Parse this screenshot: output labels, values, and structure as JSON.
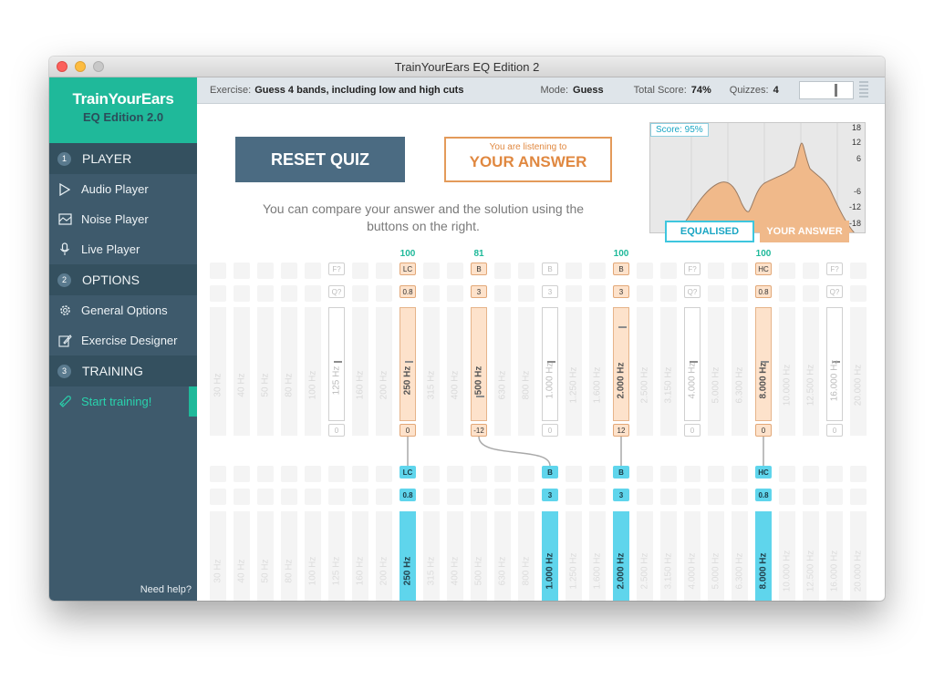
{
  "window": {
    "title": "TrainYourEars EQ Edition 2"
  },
  "brand": {
    "name": "TrainYourEars",
    "edition": "EQ Edition 2.0"
  },
  "sidebar": {
    "sections": [
      {
        "num": "1",
        "label": "PLAYER",
        "items": [
          "Audio Player",
          "Noise Player",
          "Live Player"
        ],
        "icons": [
          "play-icon",
          "noise-icon",
          "mic-icon"
        ]
      },
      {
        "num": "2",
        "label": "OPTIONS",
        "items": [
          "General Options",
          "Exercise Designer"
        ],
        "icons": [
          "gear-icon",
          "edit-icon"
        ]
      },
      {
        "num": "3",
        "label": "TRAINING",
        "items": [
          "Start training!"
        ],
        "icons": [
          "rocket-icon"
        ]
      }
    ],
    "help": "Need help?"
  },
  "topbar": {
    "exercise_label": "Exercise:",
    "exercise_value": "Guess 4 bands, including low and high cuts",
    "mode_label": "Mode:",
    "mode_value": "Guess",
    "score_label": "Total Score:",
    "score_value": "74%",
    "quizzes_label": "Quizzes:",
    "quizzes_value": "4"
  },
  "main": {
    "reset_label": "RESET QUIZ",
    "listening_small": "You are listening to",
    "listening_big": "YOUR ANSWER",
    "compare_text": "You can compare your answer and the solution using the buttons on the right."
  },
  "graph": {
    "score": "Score: 95%",
    "y_labels": [
      "18",
      "12",
      "6",
      "-6",
      "-12",
      "-18"
    ],
    "equalised_label": "EQUALISED",
    "your_answer_label": "YOUR ANSWER",
    "colors": {
      "answer_fill": "#f0b98a",
      "solution": "#5fd5ec"
    }
  },
  "freqs": [
    "30 Hz",
    "40 Hz",
    "50 Hz",
    "80 Hz",
    "100 Hz",
    "125 Hz",
    "160 Hz",
    "200 Hz",
    "250 Hz",
    "315 Hz",
    "400 Hz",
    "500 Hz",
    "630 Hz",
    "800 Hz",
    "1.000 Hz",
    "1.250 Hz",
    "1.600 Hz",
    "2.000 Hz",
    "2.500 Hz",
    "3.150 Hz",
    "4.000 Hz",
    "5.000 Hz",
    "6.300 Hz",
    "8.000 Hz",
    "10.000 Hz",
    "12.500 Hz",
    "16.000 Hz",
    "20.000 Hz"
  ],
  "answer_bands": [
    {
      "col": 5,
      "scores": "",
      "type": "F?",
      "q": "Q?",
      "freq": "125 Hz",
      "gain": "0",
      "active": false
    },
    {
      "col": 8,
      "scores": "100",
      "type": "LC",
      "q": "0.8",
      "freq": "250 Hz",
      "gain": "0",
      "active": true
    },
    {
      "col": 11,
      "scores": "81",
      "type": "B",
      "q": "3",
      "freq": "500 Hz",
      "gain": "-12",
      "active": true
    },
    {
      "col": 14,
      "scores": "",
      "type": "B",
      "q": "3",
      "freq": "1.000 Hz",
      "gain": "0",
      "active": false
    },
    {
      "col": 17,
      "scores": "100",
      "type": "B",
      "q": "3",
      "freq": "2.000 Hz",
      "gain": "12",
      "active": true
    },
    {
      "col": 20,
      "scores": "",
      "type": "F?",
      "q": "Q?",
      "freq": "4.000 Hz",
      "gain": "0",
      "active": false
    },
    {
      "col": 23,
      "scores": "100",
      "type": "HC",
      "q": "0.8",
      "freq": "8.000 Hz",
      "gain": "0",
      "active": true
    },
    {
      "col": 26,
      "scores": "",
      "type": "F?",
      "q": "Q?",
      "freq": "16.000 Hz",
      "gain": "0",
      "active": false
    }
  ],
  "solution_bands": [
    {
      "col": 8,
      "type": "LC",
      "q": "0.8",
      "freq": "250 Hz",
      "gain": "0"
    },
    {
      "col": 14,
      "type": "B",
      "q": "3",
      "freq": "1.000 Hz",
      "gain": "-12"
    },
    {
      "col": 17,
      "type": "B",
      "q": "3",
      "freq": "2.000 Hz",
      "gain": "12"
    },
    {
      "col": 23,
      "type": "HC",
      "q": "0.8",
      "freq": "8.000 Hz",
      "gain": "0"
    }
  ]
}
